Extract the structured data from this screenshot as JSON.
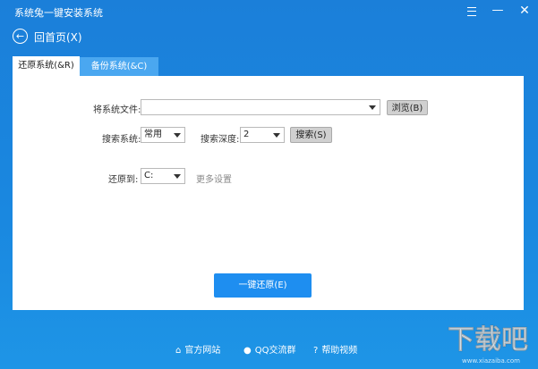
{
  "window": {
    "title": "系统兔一键安装系统",
    "menu_icon": "menu-icon",
    "minimize_icon": "minimize-icon",
    "close_glyph": "✕"
  },
  "nav": {
    "back_label": "回首页(X)",
    "back_icon": "arrow-left-circle-icon"
  },
  "tabs": [
    {
      "label": "还原系统(&R)",
      "active": true
    },
    {
      "label": "备份系统(&C)",
      "active": false
    }
  ],
  "form": {
    "file_label": "将系统文件:",
    "file_value": "",
    "browse_label": "浏览(B)",
    "search_system_label": "搜索系统:",
    "search_system_value": "常用",
    "search_depth_label": "搜索深度:",
    "search_depth_value": "2",
    "search_button": "搜索(S)",
    "restore_to_label": "还原到:",
    "restore_to_value": "C:",
    "more_settings": "更多设置",
    "restore_button": "一键还原(E)"
  },
  "footer": {
    "items": [
      {
        "label": "官方网站",
        "icon": "home-icon"
      },
      {
        "label": "QQ交流群",
        "icon": "qq-icon"
      },
      {
        "label": "帮助视频",
        "icon": "help-icon"
      }
    ]
  },
  "watermark": {
    "brand": "下载吧",
    "url": "www.xiazaiba.com"
  },
  "colors": {
    "window_blue": "#1a7fd6",
    "tab_inactive": "#4aa7f0",
    "primary_button": "#1e8ef0"
  }
}
